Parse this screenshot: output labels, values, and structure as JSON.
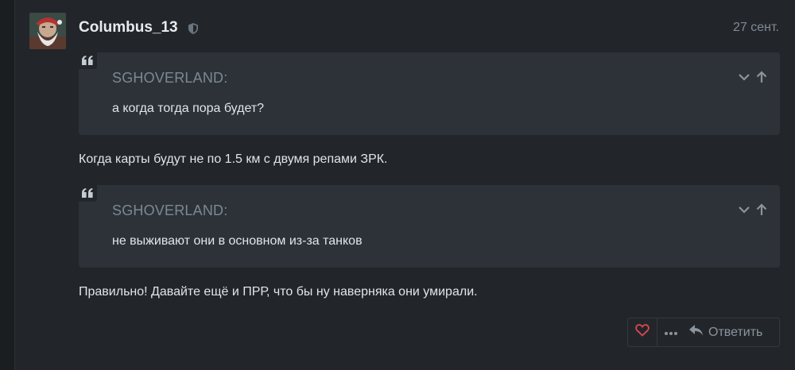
{
  "post": {
    "author": "Columbus_13",
    "date": "27 сент.",
    "quote1": {
      "author": "SGHOVERLAND:",
      "text": "а когда тогда пора будет?"
    },
    "reply1": "Когда карты будут не по 1.5 км с двумя репами ЗРК.",
    "quote2": {
      "author": "SGHOVERLAND:",
      "text": "не выживают они в основном из-за танков"
    },
    "reply2": "Правильно! Давайте ещё и ПРР, что бы ну наверняка они умирали."
  },
  "actions": {
    "reply_label": "Ответить",
    "heart_color": "#e0464f"
  },
  "icons": [
    "avatar",
    "shield-icon",
    "quote-icon",
    "chevron-down-icon",
    "arrow-up-icon",
    "heart-icon",
    "more-icon",
    "reply-icon"
  ]
}
